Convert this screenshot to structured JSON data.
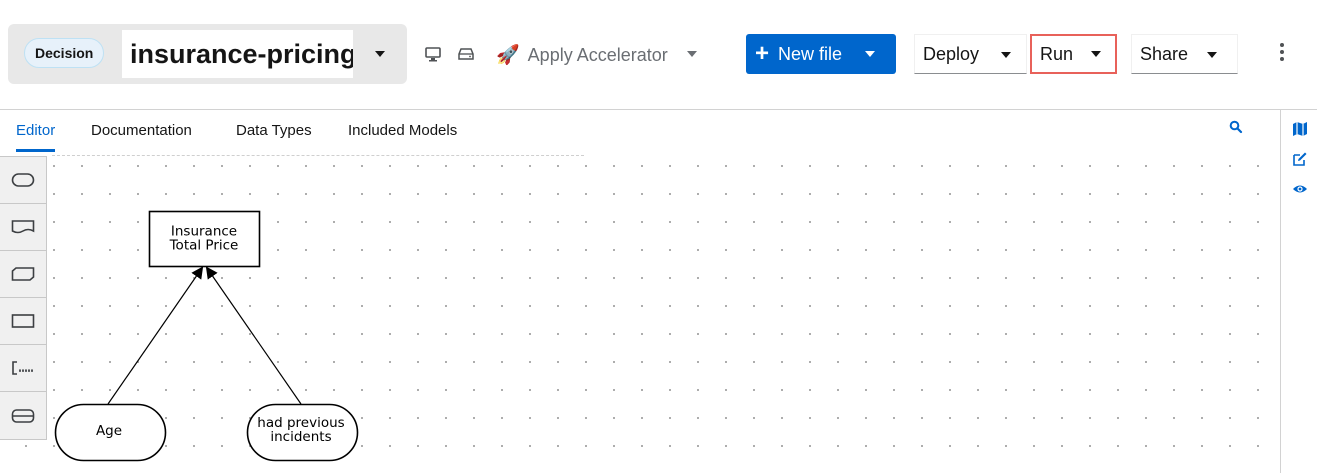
{
  "header": {
    "model_type_badge": "Decision",
    "file_name": "insurance-pricing",
    "accelerator_label": "Apply Accelerator",
    "new_file_label": "New file",
    "deploy_label": "Deploy",
    "run_label": "Run",
    "share_label": "Share"
  },
  "tabs": [
    {
      "label": "Editor",
      "active": true
    },
    {
      "label": "Documentation",
      "active": false
    },
    {
      "label": "Data Types",
      "active": false
    },
    {
      "label": "Included Models",
      "active": false
    }
  ],
  "palette": [
    "decision",
    "input-data",
    "business-knowledge-model",
    "knowledge-source",
    "text-annotation",
    "decision-service"
  ],
  "diagram": {
    "nodes": {
      "decision": {
        "line1": "Insurance",
        "line2": "Total Price"
      },
      "input_age": {
        "label": "Age"
      },
      "input_incidents": {
        "line1": "had previous",
        "line2": "incidents"
      }
    }
  },
  "colors": {
    "primary": "#0066cc",
    "highlight_border": "#e8615a",
    "badge_bg": "#e7f1fa"
  }
}
